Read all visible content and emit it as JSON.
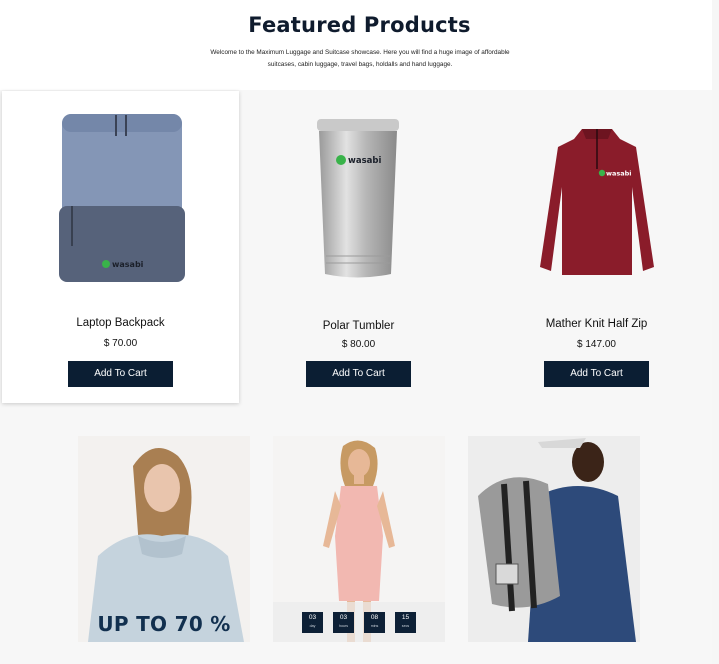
{
  "header": {
    "title": "Featured Products",
    "subtitle": "Welcome to the Maximum Luggage and Suitcase showcase. Here you will find a huge image of affordable suitcases, cabin luggage, travel bags, holdalls and hand luggage."
  },
  "products": [
    {
      "name": "Laptop Backpack",
      "price": "$ 70.00",
      "button": "Add To Cart",
      "brand": "wasabi",
      "image": "backpack-image"
    },
    {
      "name": "Polar Tumbler",
      "price": "$ 80.00",
      "button": "Add To Cart",
      "brand": "wasabi",
      "image": "tumbler-image"
    },
    {
      "name": "Mather Knit Half Zip",
      "price": "$ 147.00",
      "button": "Add To Cart",
      "brand": "wasabi",
      "image": "half-zip-jacket-image"
    }
  ],
  "promos": {
    "sale_text": "UP TO 70 %",
    "countdown": [
      {
        "value": "03",
        "label": "day"
      },
      {
        "value": "03",
        "label": "hours"
      },
      {
        "value": "08",
        "label": "mins"
      },
      {
        "value": "15",
        "label": "secs"
      }
    ]
  },
  "colors": {
    "button": "#0b1e33",
    "title": "#0f1b2d",
    "promo_text": "#12304f"
  }
}
